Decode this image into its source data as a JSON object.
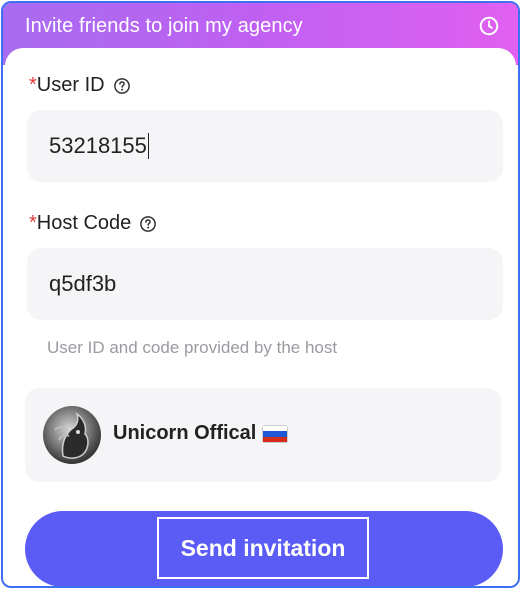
{
  "header": {
    "title": "Invite friends to join my agency",
    "history_icon": "clock-icon"
  },
  "form": {
    "user_id": {
      "required_mark": "*",
      "label": "User ID",
      "value": "53218155",
      "help_icon": "question-circle-icon"
    },
    "host_code": {
      "required_mark": "*",
      "label": "Host Code",
      "value": "q5df3b",
      "help_icon": "question-circle-icon"
    },
    "hint": "User ID and code provided by the host"
  },
  "host": {
    "name": "Unicorn Offical",
    "flag_icon": "russia-flag-icon",
    "avatar_icon": "unicorn-avatar"
  },
  "actions": {
    "send_label": "Send invitation"
  },
  "colors": {
    "header_gradient_start": "#a86cf0",
    "header_gradient_end": "#e060f0",
    "primary_button": "#5a5cf5",
    "required": "#e23b3b",
    "frame_border": "#3f6ff2"
  }
}
